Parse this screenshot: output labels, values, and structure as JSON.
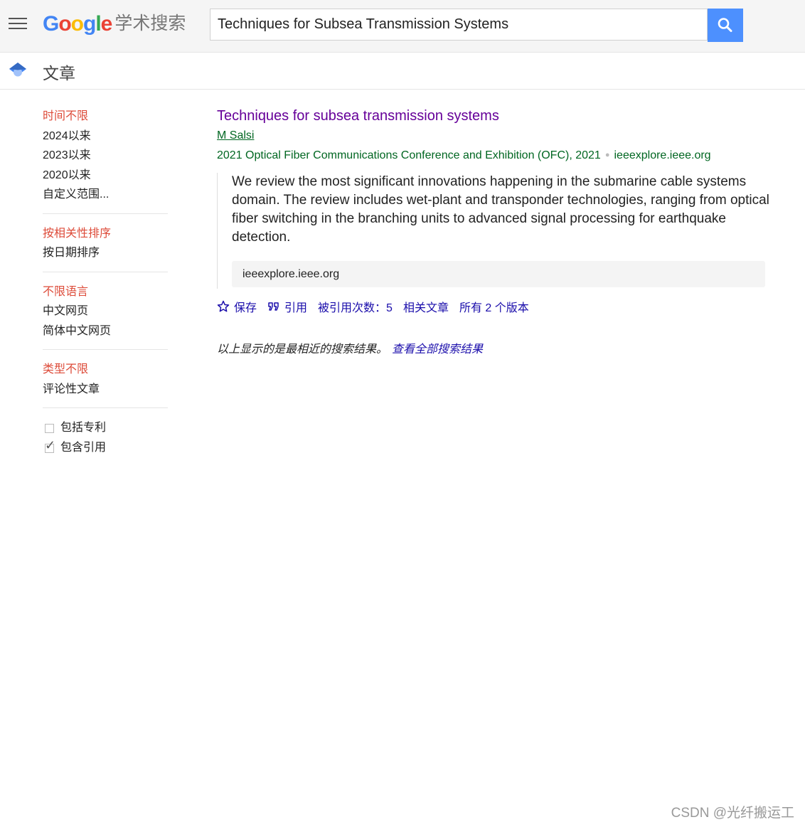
{
  "logo": {
    "letters": [
      "G",
      "o",
      "o",
      "g",
      "l",
      "e"
    ],
    "letter_colors": [
      "#4285f4",
      "#ea4335",
      "#fbbc05",
      "#4285f4",
      "#34a853",
      "#ea4335"
    ],
    "suffix": "学术搜索"
  },
  "search": {
    "query": "Techniques for Subsea Transmission Systems"
  },
  "subbar": {
    "title": "文章"
  },
  "sidebar": {
    "time": [
      "时间不限",
      "2024以来",
      "2023以来",
      "2020以来",
      "自定义范围..."
    ],
    "sort": [
      "按相关性排序",
      "按日期排序"
    ],
    "language": [
      "不限语言",
      "中文网页",
      "简体中文网页"
    ],
    "type": [
      "类型不限",
      "评论性文章"
    ],
    "checks": [
      {
        "label": "包括专利",
        "checked": false
      },
      {
        "label": "包含引用",
        "checked": true
      }
    ]
  },
  "result": {
    "title": "Techniques for subsea transmission systems",
    "author": "M Salsi",
    "venue": "2021 Optical Fiber Communications Conference and Exhibition (OFC), 2021",
    "domain": "ieeexplore.ieee.org",
    "abstract": "We review the most significant innovations happening in the submarine cable systems domain. The review includes wet-plant and transponder technologies, ranging from optical fiber switching in the branching units to advanced signal processing for earthquake detection.",
    "source": "ieeexplore.ieee.org",
    "actions": {
      "save": "保存",
      "cite": "引用",
      "cited_by": "被引用次数：5",
      "related": "相关文章",
      "versions": "所有 2 个版本"
    }
  },
  "note": {
    "text": "以上显示的是最相近的搜索结果。",
    "link": "查看全部搜索结果"
  },
  "watermark": "CSDN @光纤搬运工",
  "colors": {
    "accent": "#4d90fe",
    "active": "#dd4b39",
    "link": "#1a0dab",
    "visited": "#660099",
    "green": "#006621"
  }
}
